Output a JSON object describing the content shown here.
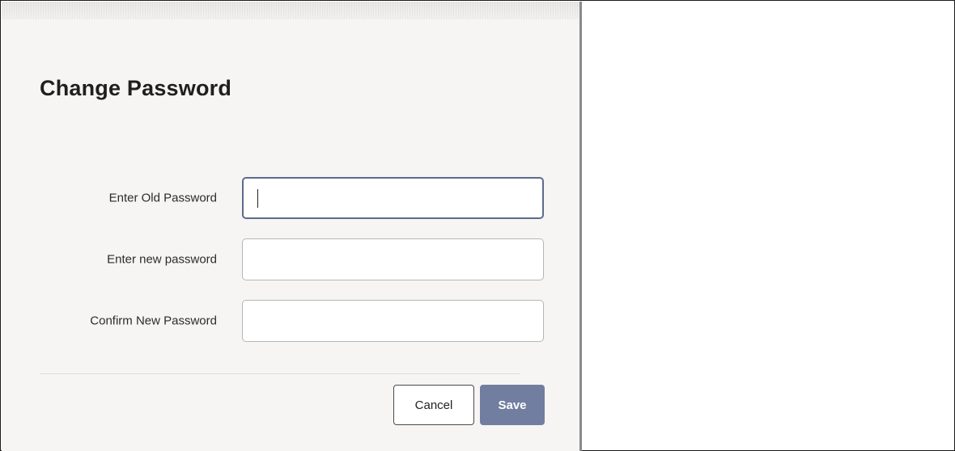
{
  "dialog": {
    "title": "Change Password",
    "fields": [
      {
        "label": "Enter Old Password",
        "value": "",
        "placeholder": ""
      },
      {
        "label": "Enter new password",
        "value": "",
        "placeholder": ""
      },
      {
        "label": "Confirm New Password",
        "value": "",
        "placeholder": ""
      }
    ],
    "buttons": {
      "cancel_label": "Cancel",
      "save_label": "Save"
    }
  },
  "colors": {
    "dialog_background": "#f6f5f3",
    "save_button": "#717ea0",
    "focus_border": "#5d6b8c"
  }
}
